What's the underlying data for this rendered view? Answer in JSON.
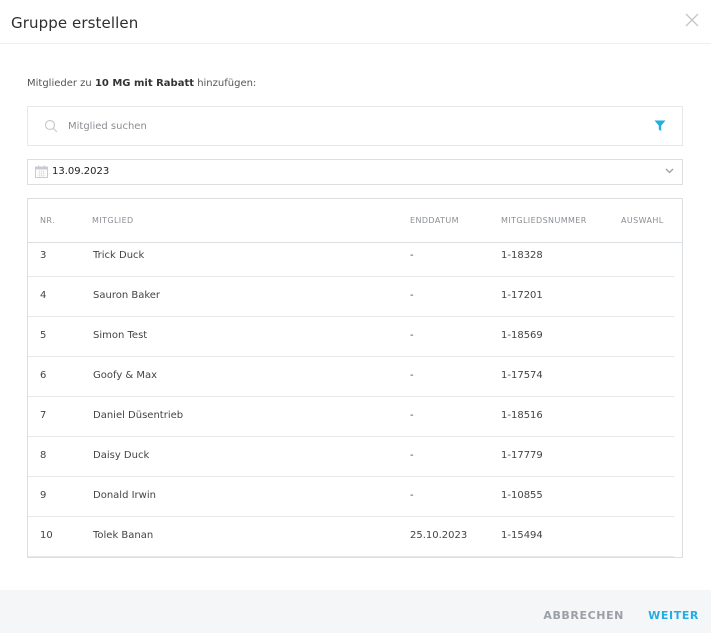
{
  "dialog": {
    "title": "Gruppe erstellen",
    "accent_color": "#22aee4"
  },
  "intro": {
    "prefix": "Mitglieder zu ",
    "group_name": "10 MG mit Rabatt",
    "suffix": " hinzufügen:"
  },
  "search": {
    "placeholder": "Mitglied suchen",
    "value": ""
  },
  "date_filter": {
    "value": "13.09.2023"
  },
  "table": {
    "headers": {
      "nr": "NR.",
      "member": "MITGLIED",
      "end_date": "ENDDATUM",
      "member_number": "MITGLIEDSNUMMER",
      "selection": "AUSWAHL"
    },
    "rows": [
      {
        "nr": "3",
        "member": "Trick Duck",
        "end_date": "-",
        "member_number": "1-18328"
      },
      {
        "nr": "4",
        "member": "Sauron Baker",
        "end_date": "-",
        "member_number": "1-17201"
      },
      {
        "nr": "5",
        "member": "Simon Test",
        "end_date": "-",
        "member_number": "1-18569"
      },
      {
        "nr": "6",
        "member": "Goofy & Max",
        "end_date": "-",
        "member_number": "1-17574"
      },
      {
        "nr": "7",
        "member": "Daniel Düsentrieb",
        "end_date": "-",
        "member_number": "1-18516"
      },
      {
        "nr": "8",
        "member": "Daisy Duck",
        "end_date": "-",
        "member_number": "1-17779"
      },
      {
        "nr": "9",
        "member": "Donald Irwin",
        "end_date": "-",
        "member_number": "1-10855"
      },
      {
        "nr": "10",
        "member": "Tolek Banan",
        "end_date": "25.10.2023",
        "member_number": "1-15494"
      }
    ]
  },
  "footer": {
    "cancel_label": "ABBRECHEN",
    "next_label": "WEITER"
  }
}
